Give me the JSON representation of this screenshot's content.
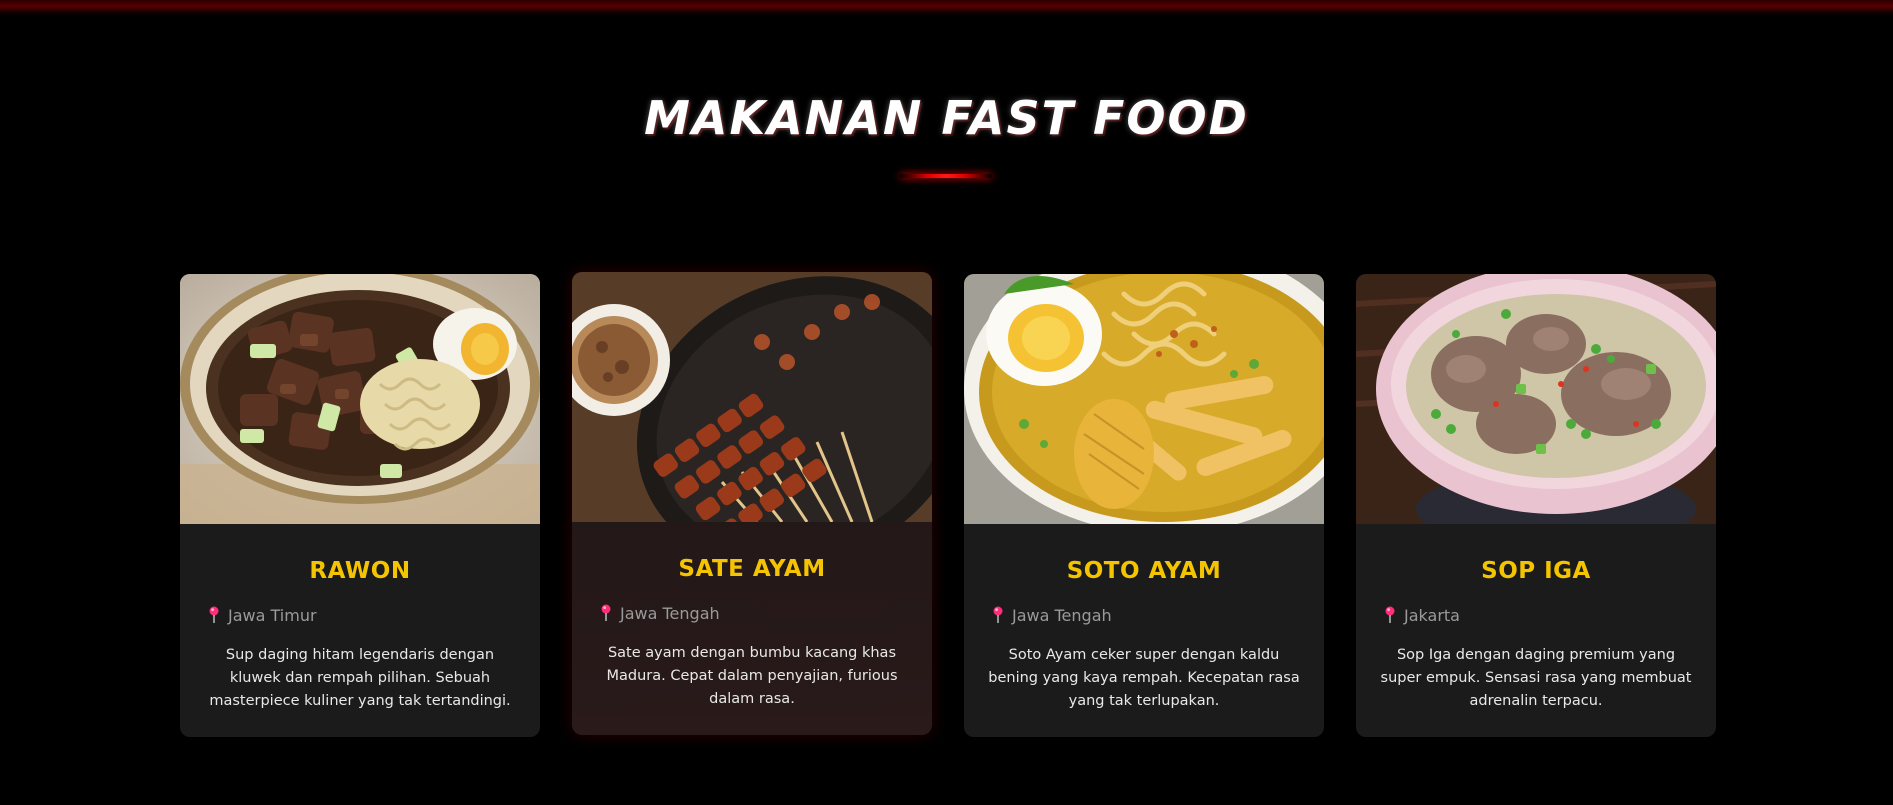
{
  "section": {
    "title": "MAKANAN FAST FOOD"
  },
  "theme": {
    "background": "#000000",
    "accent_red": "#e00000",
    "title_yellow": "#f5c400",
    "card_bg": "#1b1b1b",
    "location_gray": "#9a9a9a"
  },
  "cards": [
    {
      "name": "RAWON",
      "location": "Jawa Timur",
      "location_icon": "map-pin-icon",
      "description": "Sup daging hitam legendaris dengan kluwek dan rempah pilihan. Sebuah masterpiece kuliner yang tak tertandingi."
    },
    {
      "name": "SATE AYAM",
      "location": "Jawa Tengah",
      "location_icon": "map-pin-icon",
      "description": "Sate ayam dengan bumbu kacang khas Madura. Cepat dalam penyajian, furious dalam rasa."
    },
    {
      "name": "SOTO AYAM",
      "location": "Jawa Tengah",
      "location_icon": "map-pin-icon",
      "description": "Soto Ayam ceker super dengan kaldu bening yang kaya rempah. Kecepatan rasa yang tak terlupakan."
    },
    {
      "name": "SOP IGA",
      "location": "Jakarta",
      "location_icon": "map-pin-icon",
      "description": "Sop Iga dengan daging premium yang super empuk. Sensasi rasa yang membuat adrenalin terpacu."
    }
  ]
}
